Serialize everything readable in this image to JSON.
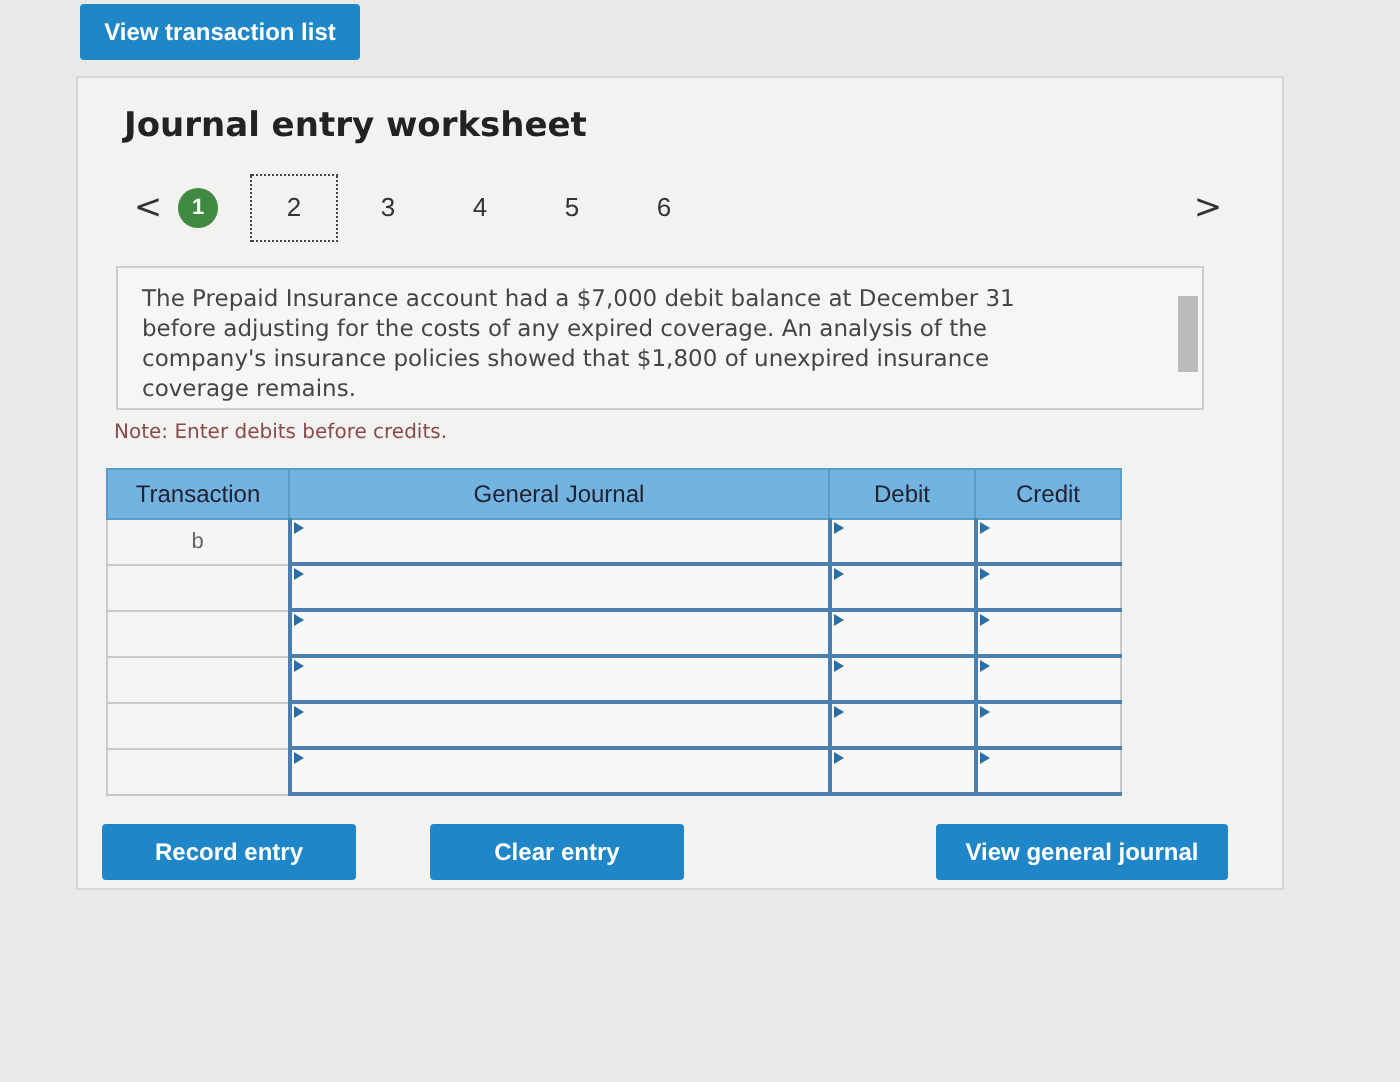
{
  "top_button": "View transaction list",
  "worksheet": {
    "title": "Journal entry worksheet",
    "prev": "<",
    "next": ">",
    "steps": [
      {
        "label": "1",
        "done": true,
        "selected": false
      },
      {
        "label": "2",
        "done": false,
        "selected": true
      },
      {
        "label": "3",
        "done": false,
        "selected": false
      },
      {
        "label": "4",
        "done": false,
        "selected": false
      },
      {
        "label": "5",
        "done": false,
        "selected": false
      },
      {
        "label": "6",
        "done": false,
        "selected": false
      }
    ],
    "description": "The Prepaid Insurance account had a $7,000 debit balance at December 31 before adjusting for the costs of any expired coverage. An analysis of the company's insurance policies showed that $1,800 of unexpired insurance coverage remains.",
    "note": "Note: Enter debits before credits.",
    "table": {
      "columns": [
        "Transaction",
        "General Journal",
        "Debit",
        "Credit"
      ],
      "rows": [
        {
          "kind": "entry",
          "transaction": "b"
        },
        {
          "kind": "entry"
        },
        {
          "kind": "entry"
        },
        {
          "kind": "entry"
        },
        {
          "kind": "entry"
        },
        {
          "kind": "entry"
        }
      ]
    },
    "buttons": [
      "Record entry",
      "Clear entry",
      "View general journal"
    ]
  }
}
